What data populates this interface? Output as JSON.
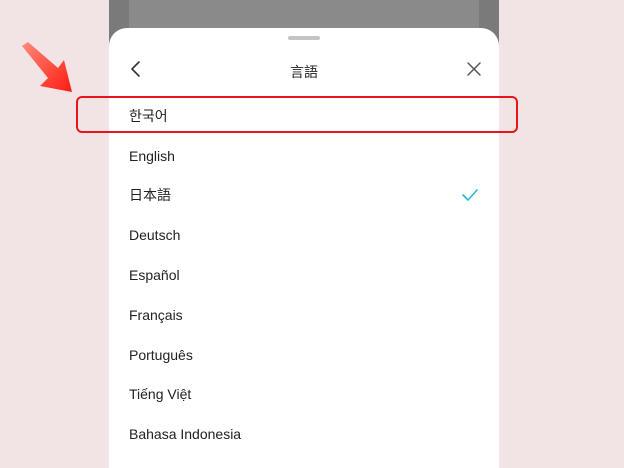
{
  "sheet": {
    "title": "言語",
    "back_icon": "chevron-left-icon",
    "close_icon": "close-icon"
  },
  "languages": [
    {
      "label": "한국어",
      "selected": false
    },
    {
      "label": "English",
      "selected": false
    },
    {
      "label": "日本語",
      "selected": true
    },
    {
      "label": "Deutsch",
      "selected": false
    },
    {
      "label": "Español",
      "selected": false
    },
    {
      "label": "Français",
      "selected": false
    },
    {
      "label": "Português",
      "selected": false
    },
    {
      "label": "Tiếng Việt",
      "selected": false
    },
    {
      "label": "Bahasa Indonesia",
      "selected": false
    }
  ],
  "colors": {
    "check": "#2bb5d8",
    "highlight": "#e8161b",
    "arrow": "#ff2a1f"
  }
}
